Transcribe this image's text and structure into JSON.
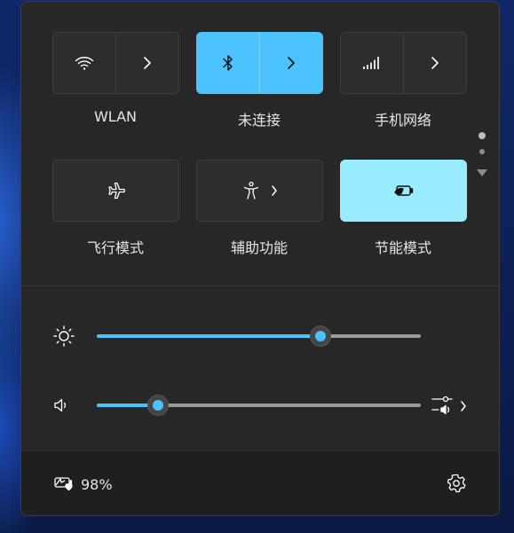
{
  "quick_settings": {
    "tiles": [
      {
        "label": "WLAN",
        "icon": "wifi-icon",
        "state": "off",
        "has_chevron": true
      },
      {
        "label": "未连接",
        "icon": "bluetooth-icon",
        "state": "on",
        "has_chevron": true
      },
      {
        "label": "手机网络",
        "icon": "cellular-icon",
        "state": "off",
        "has_chevron": true
      },
      {
        "label": "飞行模式",
        "icon": "airplane-icon",
        "state": "off",
        "has_chevron": false
      },
      {
        "label": "辅助功能",
        "icon": "accessibility-icon",
        "state": "off",
        "has_chevron": true
      },
      {
        "label": "节能模式",
        "icon": "battery-saver-icon",
        "state": "on",
        "has_chevron": false
      }
    ],
    "page_indicator": {
      "pages": 2,
      "current": 1
    }
  },
  "sliders": {
    "brightness": {
      "icon": "brightness-icon",
      "value": 0.69
    },
    "volume": {
      "icon": "speaker-icon",
      "value": 0.19
    }
  },
  "footer": {
    "battery_icon": "battery-charging-icon",
    "battery_percent": "98%",
    "settings_icon": "gear-icon"
  },
  "colors": {
    "accent": "#4cc2ff",
    "energy_saver": "#99ebff",
    "panel": "#272727",
    "tile": "#2d2d2d"
  }
}
